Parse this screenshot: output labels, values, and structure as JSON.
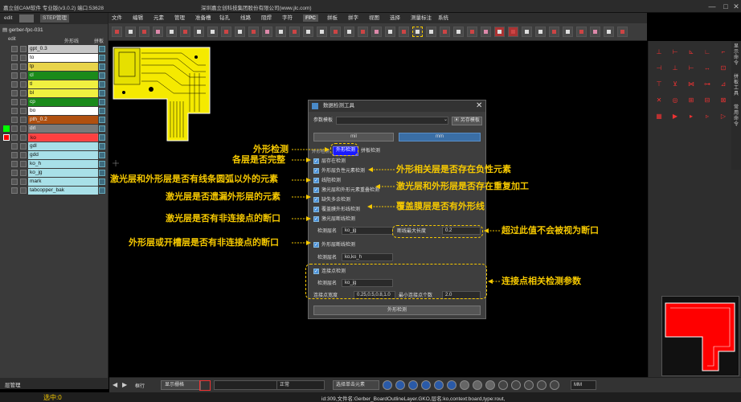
{
  "window": {
    "title": "嘉立创CAM软件 专业版(v3.0.2) 端口:53628",
    "company": "深圳嘉立创科技集团股份有限公司(www.jlc.com)"
  },
  "left_panel": {
    "tabs": [
      "edit",
      "STEP管理"
    ],
    "project": "gerber-fpc-031",
    "edit_label": "edit",
    "col_outline": "外形线",
    "col_splice": "拼板",
    "layers": [
      {
        "name": "gpt_0.3",
        "color": "#c8c8c8"
      },
      {
        "name": "to",
        "color": "#ffffff"
      },
      {
        "name": "tp",
        "color": "#e8d44a"
      },
      {
        "name": "cl",
        "color": "#1a8a1a"
      },
      {
        "name": "tl",
        "color": "#f0f040"
      },
      {
        "name": "bl",
        "color": "#f0f040"
      },
      {
        "name": "cp",
        "color": "#1a8a1a"
      },
      {
        "name": "bo",
        "color": "#ffffff"
      },
      {
        "name": "pth_0.2",
        "color": "#b05010"
      },
      {
        "name": "drl",
        "color": "#7a7a7a"
      },
      {
        "name": "ko",
        "color": "#ff4040"
      },
      {
        "name": "gdl",
        "color": "#a8e0e8"
      },
      {
        "name": "gdd",
        "color": "#a8e0e8"
      },
      {
        "name": "ko_h",
        "color": "#a8e0e8"
      },
      {
        "name": "ko_jg",
        "color": "#a8e0e8"
      },
      {
        "name": "mark",
        "color": "#a8e0e8"
      },
      {
        "name": "tabcopper_bak",
        "color": "#a8e0e8"
      }
    ],
    "footer_label": "层管理",
    "selected": "选中:0"
  },
  "menu": [
    "文件",
    "编辑",
    "元素",
    "管理",
    "准备槽",
    "钻孔",
    "线路",
    "阻焊",
    "字符",
    "FPC",
    "拼板",
    "拼字",
    "视图",
    "选择",
    "测量标注",
    "系统"
  ],
  "dialog": {
    "title": "数据检测工具",
    "param_template_label": "参数模板",
    "save_template": "另存模板",
    "unit_mil": "mil",
    "unit_mm": "mm",
    "tabs": [
      "外形检测",
      "拼板检测"
    ],
    "left_tab_label": "外形检测",
    "checks": [
      "层存在检测",
      "外形层负性元素检测",
      "线阻检测",
      "激光层和外形元素重叠检测",
      "缺失多余检测",
      "覆盖膜外形线检测",
      "激光层断线检测"
    ],
    "laser_check_layer_label": "检测层名",
    "laser_check_layer_value": "ko_jg",
    "max_break_label": "断线最大长度",
    "max_break_value": "0.2",
    "outline_break_check": "外形层断线检测",
    "outline_check_layer_label": "检测层名",
    "outline_check_layer_value": "ko,ko_h",
    "connect_check": "连接点检测",
    "connect_layer_label": "检测层名",
    "connect_layer_value": "ko_jg",
    "connect_width_label": "连接点宽度",
    "connect_width_value": "0.25,0.5,0.8,1.0",
    "min_count_label": "最小连接点个数",
    "min_count_value": "2.0",
    "run_button": "外形检测"
  },
  "annotations": {
    "outline_check": "外形检测",
    "layers_complete": "各层是否完整",
    "non_line_arc": "激光层和外形层是否有线条圆弧以外的元素",
    "missing_outline": "激光层是否遗漏外形层的元素",
    "laser_break": "激光层是否有非连接点的断口",
    "outline_break": "外形层或开槽层是否有非连接点的断口",
    "negative_elements": "外形相关层是否存在负性元素",
    "duplicate": "激光层和外形层是否存在重复加工",
    "coverlay": "覆盖膜层是否有外形线",
    "threshold": "超过此值不会被视为断口",
    "connect_params": "连接点相关检测参数"
  },
  "statusbar": {
    "info": "id:309,文件名:Gerber_BoardOutlineLayer.GKO,层名:ko,context:board,type:rout,",
    "mode1": "框行",
    "display_grid": "显示栅格",
    "normal": "正常",
    "select_all": "选择单击元素",
    "unit": "MM"
  },
  "colors": {
    "accent": "#f5c800",
    "highlight": "#0000ff",
    "selection": "#ff0000"
  }
}
